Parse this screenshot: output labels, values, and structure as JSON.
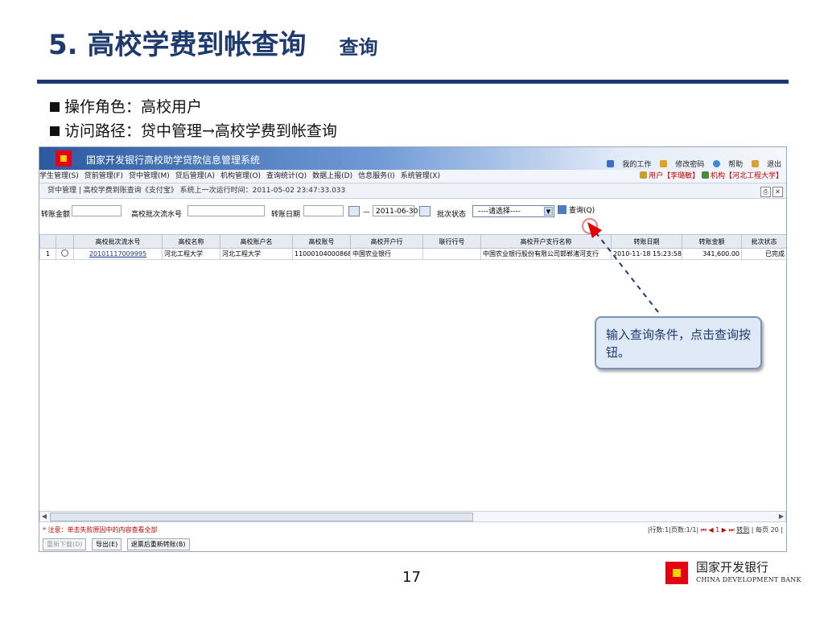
{
  "slide": {
    "title": "5. 高校学费到帐查询",
    "subtitle": "查询",
    "bullets": [
      "操作角色：高校用户",
      "访问路径：贷中管理→高校学费到帐查询"
    ],
    "page_number": "17",
    "callout": "输入查询条件，点击查询按钮。"
  },
  "app": {
    "title": "国家开发银行高校助学贷款信息管理系统",
    "top_links": [
      "我的工作",
      "修改密码",
      "帮助",
      "退出"
    ],
    "menus": [
      "学生管理(S)",
      "贷前管理(F)",
      "贷中管理(M)",
      "贷后管理(A)",
      "机构管理(O)",
      "查询统计(Q)",
      "数据上报(D)",
      "信息服务(I)",
      "系统管理(X)"
    ],
    "user_info": "用户【李璐敏】",
    "org_info": "机构【河北工程大学】",
    "breadcrumb": "贷中管理 | 高校学费到账查询《支付宝》 系统上一次运行时间：2011-05-02 23:47:33.033"
  },
  "filter": {
    "amount_label": "转账金额",
    "batch_label": "高校批次流水号",
    "date_label": "转账日期",
    "date_sep": "—",
    "date_end": "2011-06-30",
    "status_label": "批次状态",
    "status_value": "----请选择----",
    "query_button": "查询(Q)"
  },
  "table": {
    "headers": [
      "",
      "",
      "高校批次流水号",
      "高校名称",
      "高校账户名",
      "高校账号",
      "高校开户行",
      "联行行号",
      "高校开户支行名称",
      "转账日期",
      "转账金额",
      "批次状态"
    ],
    "rows": [
      [
        "1",
        "",
        "20101117009995",
        "河北工程大学",
        "河北工程大学",
        "110001040008687",
        "中国农业银行",
        "",
        "中国农业银行股份有限公司邯郸渚河支行",
        "2010-11-18 15:23:58",
        "341,600.00",
        "已完成"
      ]
    ]
  },
  "footer": {
    "note": "* 注意：单击失败原因中的内容查看全部",
    "pager_info": "|行数:1|页数:1/1|",
    "pager_nav": "⏮ ◀ 1 ▶ ⏭",
    "goto": "转到",
    "per_page_label": "每页",
    "per_page_value": "20",
    "buttons": [
      "重新下载(D)",
      "导出(E)",
      "退票后重新转账(B)"
    ]
  },
  "colors": {
    "title": "#1f3a6e",
    "brand_red": "#e60012",
    "brand_yellow": "#ffd000"
  },
  "bank": {
    "name_cn": "国家开发银行",
    "name_en": "CHINA DEVELOPMENT BANK"
  }
}
